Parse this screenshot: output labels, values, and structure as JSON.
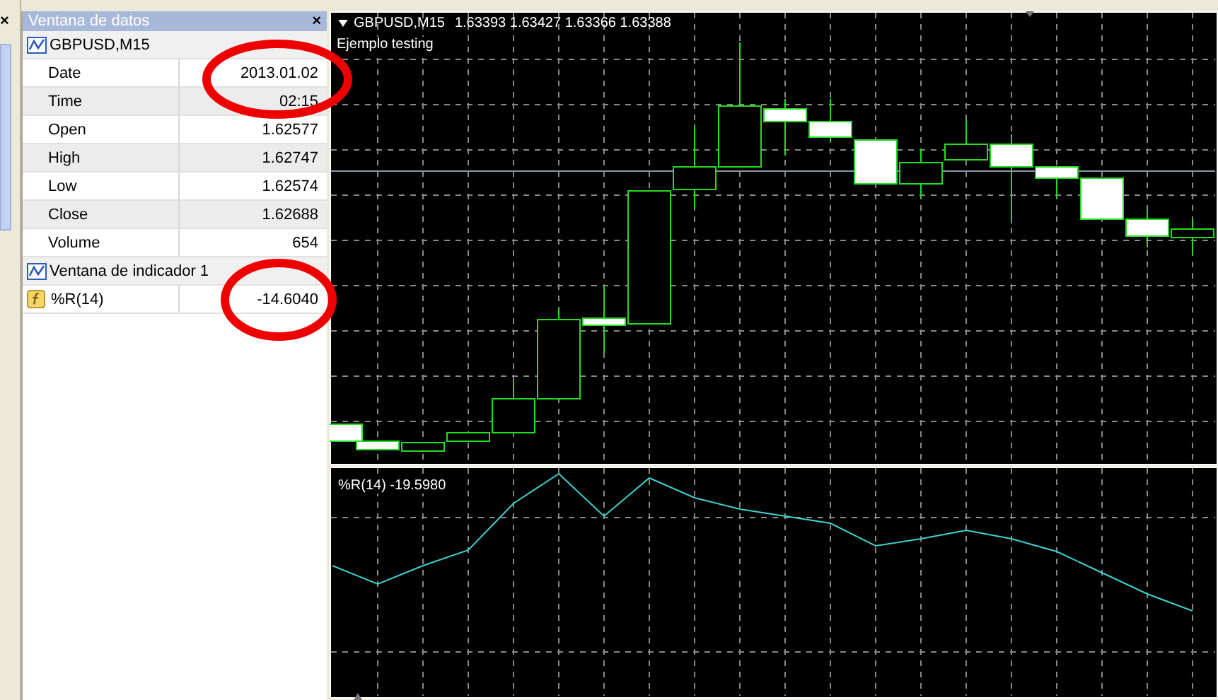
{
  "left_panel": {
    "close": "×"
  },
  "data_window": {
    "title": "Ventana de datos",
    "close": "×",
    "rows": [
      {
        "kind": "header",
        "label": "GBPUSD,M15"
      },
      {
        "kind": "field",
        "label": "Date",
        "value": "2013.01.02"
      },
      {
        "kind": "field",
        "label": "Time",
        "value": "02:15"
      },
      {
        "kind": "field",
        "label": "Open",
        "value": "1.62577"
      },
      {
        "kind": "field",
        "label": "High",
        "value": "1.62747"
      },
      {
        "kind": "field",
        "label": "Low",
        "value": "1.62574"
      },
      {
        "kind": "field",
        "label": "Close",
        "value": "1.62688"
      },
      {
        "kind": "field",
        "label": "Volume",
        "value": "654"
      },
      {
        "kind": "header",
        "label": "Ventana de indicador 1"
      },
      {
        "kind": "indicator",
        "label": "%R(14)",
        "value": "-14.6040"
      }
    ]
  },
  "chart": {
    "symbol": "GBPUSD,M15",
    "prices": "1.63393 1.63427 1.63366 1.63388",
    "caption": "Ejemplo testing",
    "indicator_label": "%R(14) -19.5980"
  },
  "annotations": [
    {
      "kind": "circle"
    },
    {
      "kind": "circle"
    }
  ]
}
